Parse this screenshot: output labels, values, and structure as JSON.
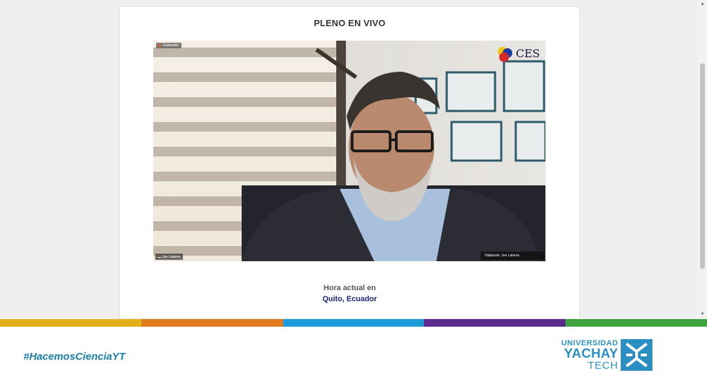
{
  "page": {
    "title": "PLENO EN VIVO"
  },
  "video": {
    "recording_label": "Grabando",
    "logo_text": "CES",
    "participant_name": "Joe Lalama",
    "speaking_label": "Hablando: Joe Lalama"
  },
  "clock": {
    "label": "Hora actual en",
    "location": "Quito, Ecuador"
  },
  "footer": {
    "hashtag_prefix": "#Hacemos",
    "hashtag_emph": "CienciaYT",
    "brand_line1": "UNIVERSIDAD",
    "brand_line2": "YACHAY",
    "brand_line3": "TECH"
  },
  "colors": {
    "stripe": [
      "#e2b11a",
      "#e07a1c",
      "#1d9bd8",
      "#5b2a8c",
      "#3ea33e"
    ],
    "brand": "#2b8fc4",
    "location": "#1a237e"
  }
}
